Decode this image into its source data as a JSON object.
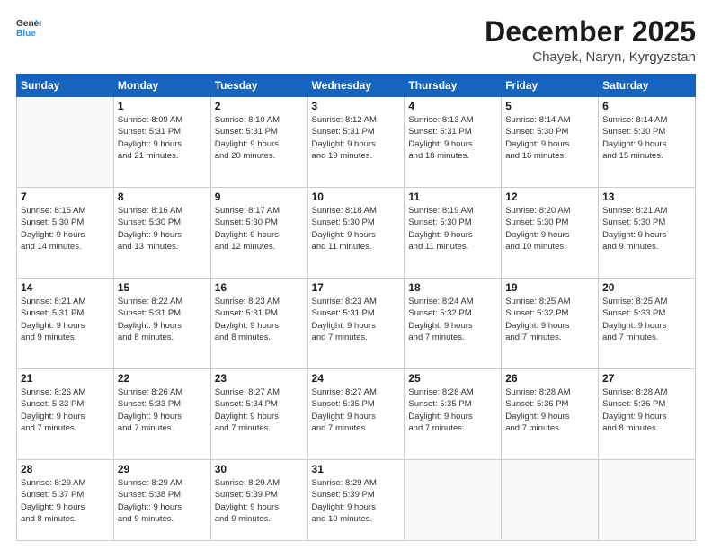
{
  "logo": {
    "line1": "General",
    "line2": "Blue"
  },
  "header": {
    "month": "December 2025",
    "location": "Chayek, Naryn, Kyrgyzstan"
  },
  "weekdays": [
    "Sunday",
    "Monday",
    "Tuesday",
    "Wednesday",
    "Thursday",
    "Friday",
    "Saturday"
  ],
  "weeks": [
    [
      {
        "day": "",
        "info": ""
      },
      {
        "day": "1",
        "info": "Sunrise: 8:09 AM\nSunset: 5:31 PM\nDaylight: 9 hours\nand 21 minutes."
      },
      {
        "day": "2",
        "info": "Sunrise: 8:10 AM\nSunset: 5:31 PM\nDaylight: 9 hours\nand 20 minutes."
      },
      {
        "day": "3",
        "info": "Sunrise: 8:12 AM\nSunset: 5:31 PM\nDaylight: 9 hours\nand 19 minutes."
      },
      {
        "day": "4",
        "info": "Sunrise: 8:13 AM\nSunset: 5:31 PM\nDaylight: 9 hours\nand 18 minutes."
      },
      {
        "day": "5",
        "info": "Sunrise: 8:14 AM\nSunset: 5:30 PM\nDaylight: 9 hours\nand 16 minutes."
      },
      {
        "day": "6",
        "info": "Sunrise: 8:14 AM\nSunset: 5:30 PM\nDaylight: 9 hours\nand 15 minutes."
      }
    ],
    [
      {
        "day": "7",
        "info": "Sunrise: 8:15 AM\nSunset: 5:30 PM\nDaylight: 9 hours\nand 14 minutes."
      },
      {
        "day": "8",
        "info": "Sunrise: 8:16 AM\nSunset: 5:30 PM\nDaylight: 9 hours\nand 13 minutes."
      },
      {
        "day": "9",
        "info": "Sunrise: 8:17 AM\nSunset: 5:30 PM\nDaylight: 9 hours\nand 12 minutes."
      },
      {
        "day": "10",
        "info": "Sunrise: 8:18 AM\nSunset: 5:30 PM\nDaylight: 9 hours\nand 11 minutes."
      },
      {
        "day": "11",
        "info": "Sunrise: 8:19 AM\nSunset: 5:30 PM\nDaylight: 9 hours\nand 11 minutes."
      },
      {
        "day": "12",
        "info": "Sunrise: 8:20 AM\nSunset: 5:30 PM\nDaylight: 9 hours\nand 10 minutes."
      },
      {
        "day": "13",
        "info": "Sunrise: 8:21 AM\nSunset: 5:30 PM\nDaylight: 9 hours\nand 9 minutes."
      }
    ],
    [
      {
        "day": "14",
        "info": "Sunrise: 8:21 AM\nSunset: 5:31 PM\nDaylight: 9 hours\nand 9 minutes."
      },
      {
        "day": "15",
        "info": "Sunrise: 8:22 AM\nSunset: 5:31 PM\nDaylight: 9 hours\nand 8 minutes."
      },
      {
        "day": "16",
        "info": "Sunrise: 8:23 AM\nSunset: 5:31 PM\nDaylight: 9 hours\nand 8 minutes."
      },
      {
        "day": "17",
        "info": "Sunrise: 8:23 AM\nSunset: 5:31 PM\nDaylight: 9 hours\nand 7 minutes."
      },
      {
        "day": "18",
        "info": "Sunrise: 8:24 AM\nSunset: 5:32 PM\nDaylight: 9 hours\nand 7 minutes."
      },
      {
        "day": "19",
        "info": "Sunrise: 8:25 AM\nSunset: 5:32 PM\nDaylight: 9 hours\nand 7 minutes."
      },
      {
        "day": "20",
        "info": "Sunrise: 8:25 AM\nSunset: 5:33 PM\nDaylight: 9 hours\nand 7 minutes."
      }
    ],
    [
      {
        "day": "21",
        "info": "Sunrise: 8:26 AM\nSunset: 5:33 PM\nDaylight: 9 hours\nand 7 minutes."
      },
      {
        "day": "22",
        "info": "Sunrise: 8:26 AM\nSunset: 5:33 PM\nDaylight: 9 hours\nand 7 minutes."
      },
      {
        "day": "23",
        "info": "Sunrise: 8:27 AM\nSunset: 5:34 PM\nDaylight: 9 hours\nand 7 minutes."
      },
      {
        "day": "24",
        "info": "Sunrise: 8:27 AM\nSunset: 5:35 PM\nDaylight: 9 hours\nand 7 minutes."
      },
      {
        "day": "25",
        "info": "Sunrise: 8:28 AM\nSunset: 5:35 PM\nDaylight: 9 hours\nand 7 minutes."
      },
      {
        "day": "26",
        "info": "Sunrise: 8:28 AM\nSunset: 5:36 PM\nDaylight: 9 hours\nand 7 minutes."
      },
      {
        "day": "27",
        "info": "Sunrise: 8:28 AM\nSunset: 5:36 PM\nDaylight: 9 hours\nand 8 minutes."
      }
    ],
    [
      {
        "day": "28",
        "info": "Sunrise: 8:29 AM\nSunset: 5:37 PM\nDaylight: 9 hours\nand 8 minutes."
      },
      {
        "day": "29",
        "info": "Sunrise: 8:29 AM\nSunset: 5:38 PM\nDaylight: 9 hours\nand 9 minutes."
      },
      {
        "day": "30",
        "info": "Sunrise: 8:29 AM\nSunset: 5:39 PM\nDaylight: 9 hours\nand 9 minutes."
      },
      {
        "day": "31",
        "info": "Sunrise: 8:29 AM\nSunset: 5:39 PM\nDaylight: 9 hours\nand 10 minutes."
      },
      {
        "day": "",
        "info": ""
      },
      {
        "day": "",
        "info": ""
      },
      {
        "day": "",
        "info": ""
      }
    ]
  ]
}
